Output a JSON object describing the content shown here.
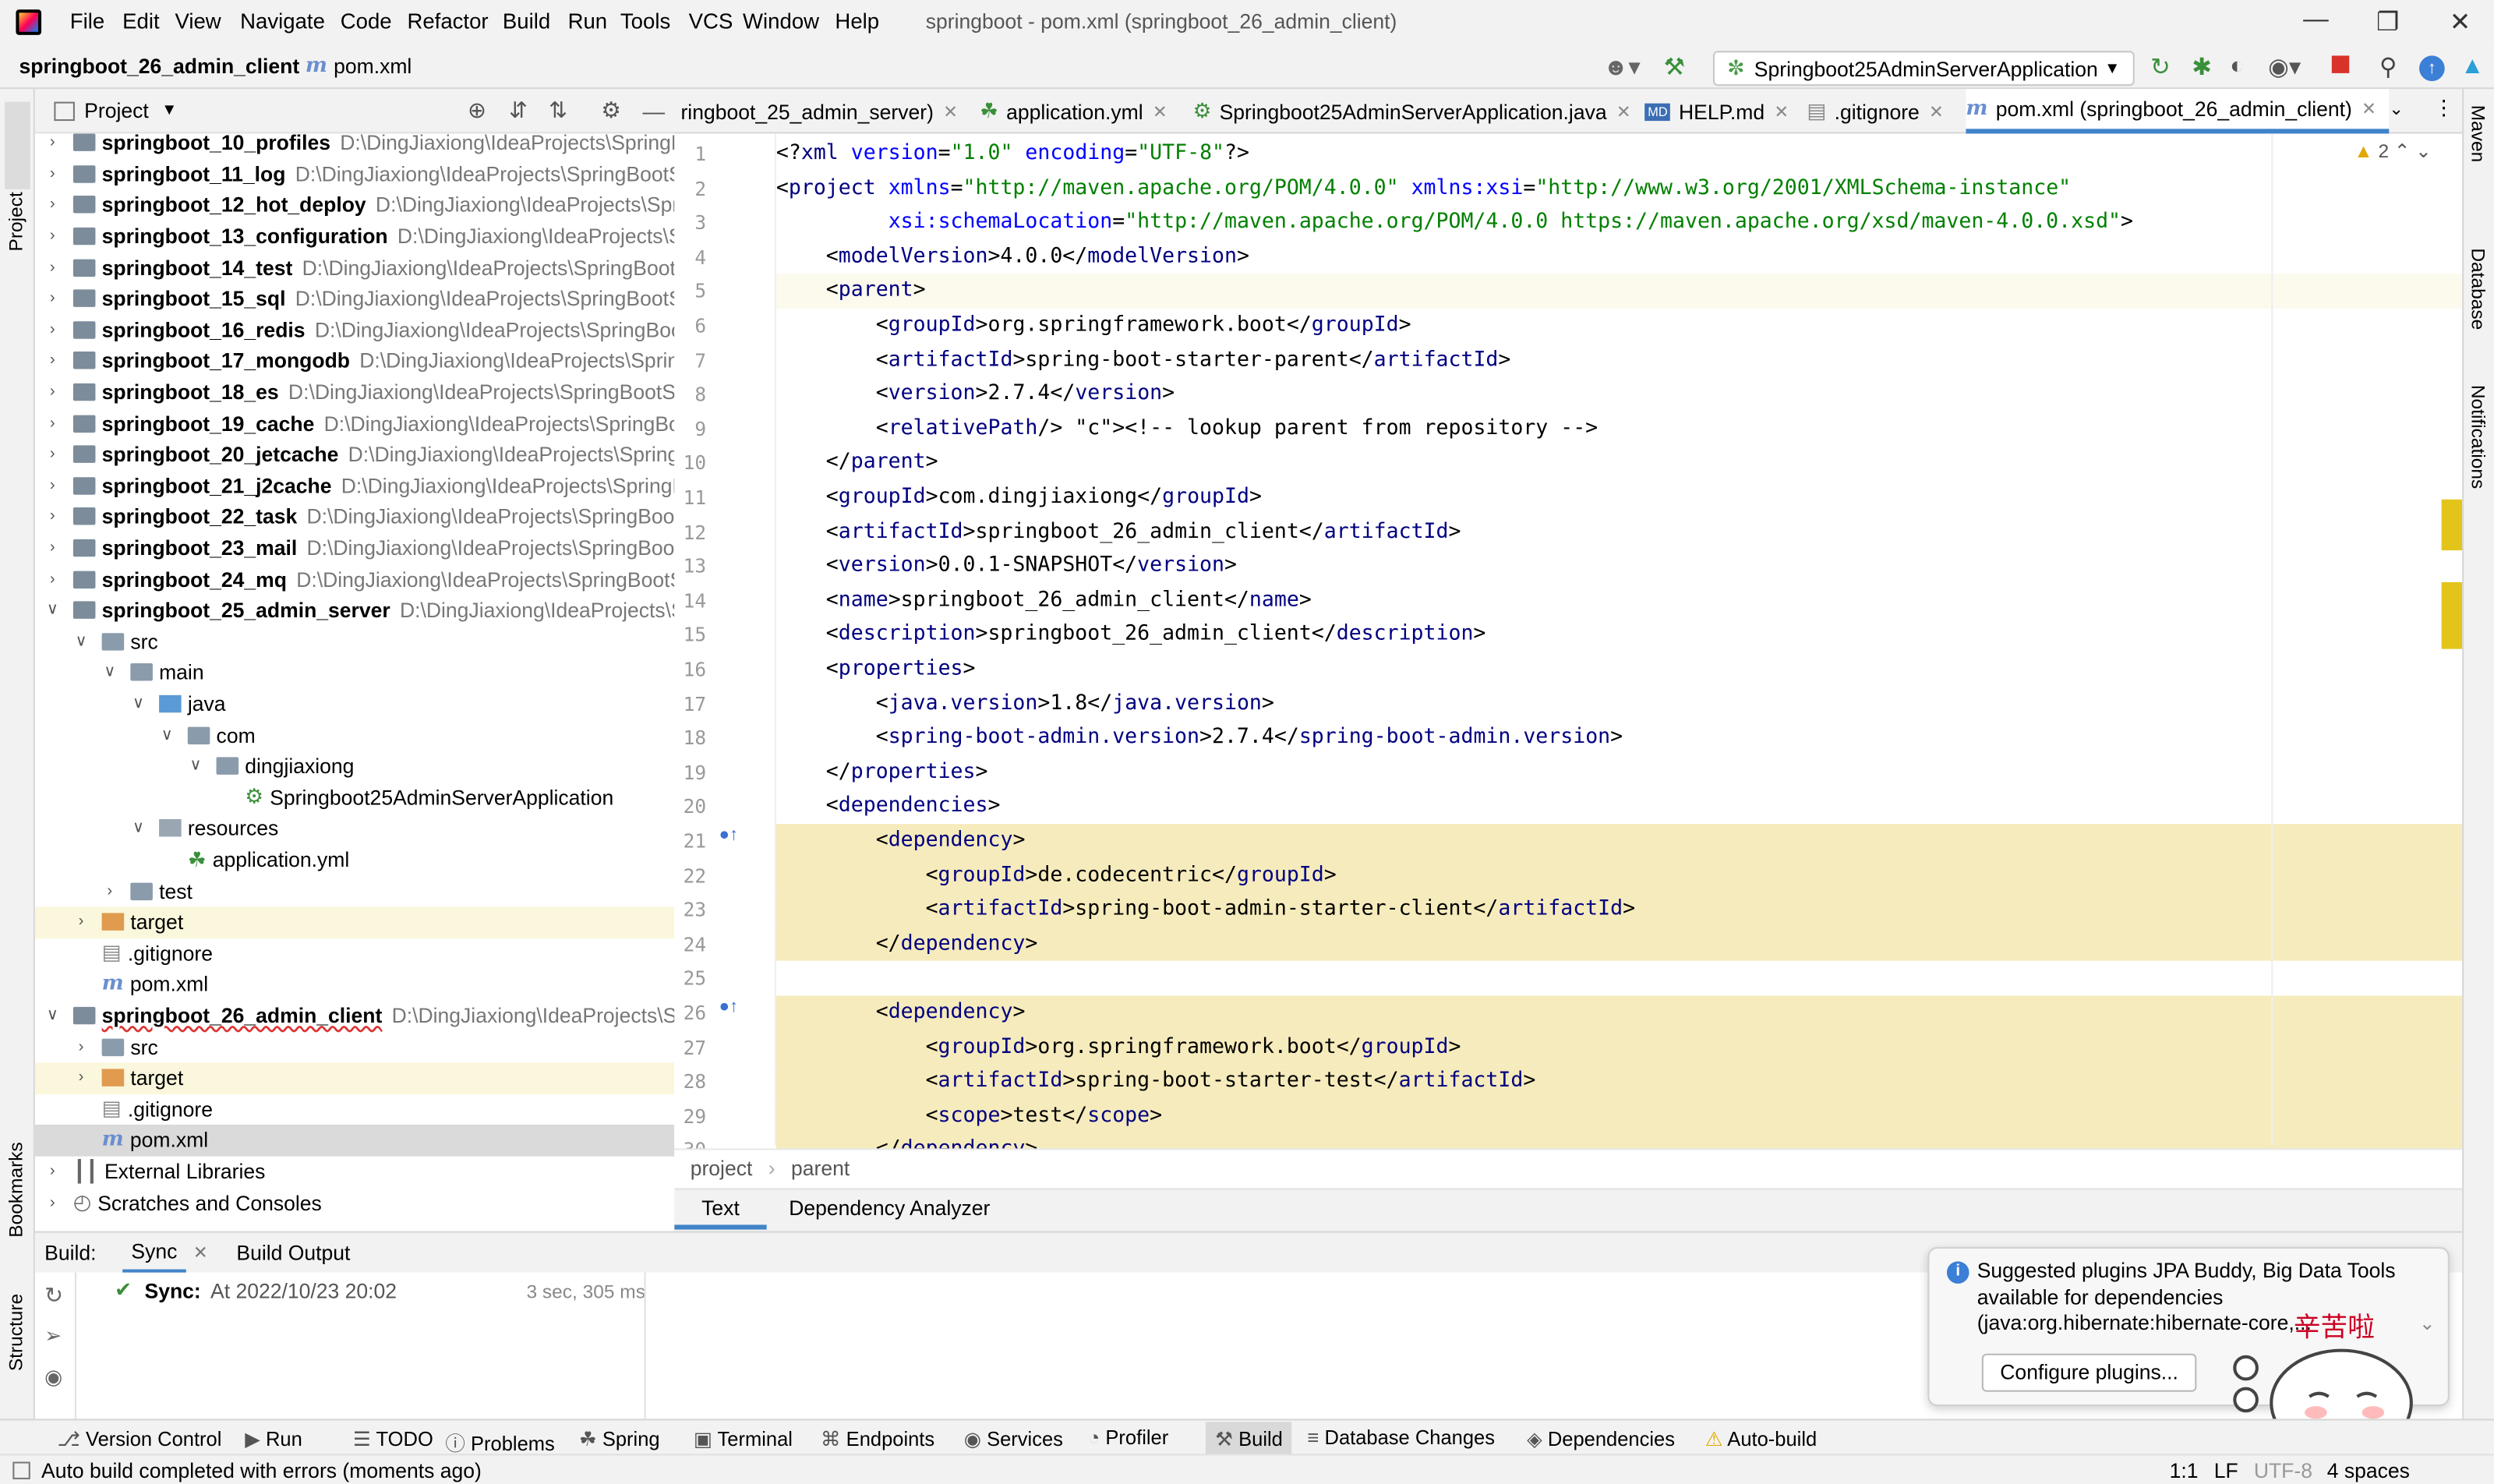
{
  "menu": [
    "File",
    "Edit",
    "View",
    "Navigate",
    "Code",
    "Refactor",
    "Build",
    "Run",
    "Tools",
    "VCS",
    "Window",
    "Help"
  ],
  "window_title": "springboot - pom.xml (springboot_26_admin_client)",
  "breadcrumb": {
    "project": "springboot_26_admin_client",
    "file": "pom.xml"
  },
  "run_config": "Springboot25AdminServerApplication",
  "project_panel": {
    "title": "Project"
  },
  "tree": [
    {
      "name": "springboot_10_profiles",
      "path": "D:\\DingJiaxiong\\IdeaProjects\\SpringBo",
      "lvl": 0,
      "arr": ">",
      "bold": true
    },
    {
      "name": "springboot_11_log",
      "path": "D:\\DingJiaxiong\\IdeaProjects\\SpringBootSt",
      "lvl": 0,
      "arr": ">",
      "bold": true
    },
    {
      "name": "springboot_12_hot_deploy",
      "path": "D:\\DingJiaxiong\\IdeaProjects\\Sprin",
      "lvl": 0,
      "arr": ">",
      "bold": true
    },
    {
      "name": "springboot_13_configuration",
      "path": "D:\\DingJiaxiong\\IdeaProjects\\Sp",
      "lvl": 0,
      "arr": ">",
      "bold": true
    },
    {
      "name": "springboot_14_test",
      "path": "D:\\DingJiaxiong\\IdeaProjects\\SpringBootSt",
      "lvl": 0,
      "arr": ">",
      "bold": true
    },
    {
      "name": "springboot_15_sql",
      "path": "D:\\DingJiaxiong\\IdeaProjects\\SpringBootStu",
      "lvl": 0,
      "arr": ">",
      "bold": true
    },
    {
      "name": "springboot_16_redis",
      "path": "D:\\DingJiaxiong\\IdeaProjects\\SpringBootS",
      "lvl": 0,
      "arr": ">",
      "bold": true
    },
    {
      "name": "springboot_17_mongodb",
      "path": "D:\\DingJiaxiong\\IdeaProjects\\Spring",
      "lvl": 0,
      "arr": ">",
      "bold": true
    },
    {
      "name": "springboot_18_es",
      "path": "D:\\DingJiaxiong\\IdeaProjects\\SpringBootStu",
      "lvl": 0,
      "arr": ">",
      "bold": true
    },
    {
      "name": "springboot_19_cache",
      "path": "D:\\DingJiaxiong\\IdeaProjects\\SpringBoot",
      "lvl": 0,
      "arr": ">",
      "bold": true
    },
    {
      "name": "springboot_20_jetcache",
      "path": "D:\\DingJiaxiong\\IdeaProjects\\SpringBo",
      "lvl": 0,
      "arr": ">",
      "bold": true
    },
    {
      "name": "springboot_21_j2cache",
      "path": "D:\\DingJiaxiong\\IdeaProjects\\SpringBo",
      "lvl": 0,
      "arr": ">",
      "bold": true
    },
    {
      "name": "springboot_22_task",
      "path": "D:\\DingJiaxiong\\IdeaProjects\\SpringBootSt",
      "lvl": 0,
      "arr": ">",
      "bold": true
    },
    {
      "name": "springboot_23_mail",
      "path": "D:\\DingJiaxiong\\IdeaProjects\\SpringBootSt",
      "lvl": 0,
      "arr": ">",
      "bold": true
    },
    {
      "name": "springboot_24_mq",
      "path": "D:\\DingJiaxiong\\IdeaProjects\\SpringBootStu",
      "lvl": 0,
      "arr": ">",
      "bold": true
    },
    {
      "name": "springboot_25_admin_server",
      "path": "D:\\DingJiaxiong\\IdeaProjects\\Spr",
      "lvl": 0,
      "arr": "v",
      "bold": true
    },
    {
      "name": "src",
      "lvl": 1,
      "arr": "v",
      "icon": "folder"
    },
    {
      "name": "main",
      "lvl": 2,
      "arr": "v",
      "icon": "folder"
    },
    {
      "name": "java",
      "lvl": 3,
      "arr": "v",
      "icon": "folder-blue"
    },
    {
      "name": "com",
      "lvl": 4,
      "arr": "v",
      "icon": "folder"
    },
    {
      "name": "dingjiaxiong",
      "lvl": 5,
      "arr": "v",
      "icon": "folder"
    },
    {
      "name": "Springboot25AdminServerApplication",
      "lvl": 6,
      "icon": "spring"
    },
    {
      "name": "resources",
      "lvl": 3,
      "arr": "v",
      "icon": "folder-res"
    },
    {
      "name": "application.yml",
      "lvl": 4,
      "icon": "yml"
    },
    {
      "name": "test",
      "lvl": 2,
      "arr": ">",
      "icon": "folder"
    },
    {
      "name": "target",
      "lvl": 1,
      "arr": ">",
      "icon": "folder-orange",
      "hl": true
    },
    {
      "name": ".gitignore",
      "lvl": 1,
      "icon": "git"
    },
    {
      "name": "pom.xml",
      "lvl": 1,
      "icon": "mvn"
    },
    {
      "name": "springboot_26_admin_client",
      "path": "D:\\DingJiaxiong\\IdeaProjects\\Spr",
      "lvl": 0,
      "arr": "v",
      "bold": true
    },
    {
      "name": "src",
      "lvl": 1,
      "arr": ">",
      "icon": "folder"
    },
    {
      "name": "target",
      "lvl": 1,
      "arr": ">",
      "icon": "folder-orange",
      "hl": true
    },
    {
      "name": ".gitignore",
      "lvl": 1,
      "icon": "git"
    },
    {
      "name": "pom.xml",
      "lvl": 1,
      "icon": "mvn",
      "sel": true
    },
    {
      "name": "External Libraries",
      "lvl": 0,
      "arr": ">",
      "icon": "lib"
    },
    {
      "name": "Scratches and Consoles",
      "lvl": 0,
      "arr": ">",
      "icon": "scratch"
    }
  ],
  "tabs": [
    {
      "label": "ringboot_25_admin_server)",
      "active": false
    },
    {
      "label": "application.yml",
      "active": false
    },
    {
      "label": "Springboot25AdminServerApplication.java",
      "active": false
    },
    {
      "label": "HELP.md",
      "active": false
    },
    {
      "label": ".gitignore",
      "active": false
    },
    {
      "label": "pom.xml (springboot_26_admin_client)",
      "active": true
    }
  ],
  "inspection_count": "2",
  "code_lines": [
    "<?xml version=\"1.0\" encoding=\"UTF-8\"?>",
    "<project xmlns=\"http://maven.apache.org/POM/4.0.0\" xmlns:xsi=\"http://www.w3.org/2001/XMLSchema-instance\"",
    "         xsi:schemaLocation=\"http://maven.apache.org/POM/4.0.0 https://maven.apache.org/xsd/maven-4.0.0.xsd\">",
    "    <modelVersion>4.0.0</modelVersion>",
    "    <parent>",
    "        <groupId>org.springframework.boot</groupId>",
    "        <artifactId>spring-boot-starter-parent</artifactId>",
    "        <version>2.7.4</version>",
    "        <relativePath/> <!-- lookup parent from repository -->",
    "    </parent>",
    "    <groupId>com.dingjiaxiong</groupId>",
    "    <artifactId>springboot_26_admin_client</artifactId>",
    "    <version>0.0.1-SNAPSHOT</version>",
    "    <name>springboot_26_admin_client</name>",
    "    <description>springboot_26_admin_client</description>",
    "    <properties>",
    "        <java.version>1.8</java.version>",
    "        <spring-boot-admin.version>2.7.4</spring-boot-admin.version>",
    "    </properties>",
    "    <dependencies>",
    "        <dependency>",
    "            <groupId>de.codecentric</groupId>",
    "            <artifactId>spring-boot-admin-starter-client</artifactId>",
    "        </dependency>",
    "",
    "        <dependency>",
    "            <groupId>org.springframework.boot</groupId>",
    "            <artifactId>spring-boot-starter-test</artifactId>",
    "            <scope>test</scope>",
    "        </dependency>"
  ],
  "editor_breadcrumb": [
    "project",
    "parent"
  ],
  "editor_bottom_tabs": [
    "Text",
    "Dependency Analyzer"
  ],
  "right_stripe": [
    "Maven",
    "Database",
    "Notifications"
  ],
  "left_stripe": [
    "Project",
    "Bookmarks",
    "Structure"
  ],
  "build": {
    "label": "Build:",
    "tabs": [
      "Sync",
      "Build Output"
    ],
    "sync_title": "Sync:",
    "sync_time": "At 2022/10/23 20:02",
    "duration": "3 sec, 305 ms"
  },
  "bottom_tabs": [
    "Version Control",
    "Run",
    "TODO",
    "Problems",
    "Spring",
    "Terminal",
    "Endpoints",
    "Services",
    "Profiler",
    "Build",
    "Database Changes",
    "Dependencies",
    "Auto-build"
  ],
  "status": {
    "message": "Auto build completed with errors (moments ago)",
    "position": "1:1",
    "line_sep": "LF",
    "encoding": "UTF-8",
    "indent": "4 spaces"
  },
  "notification": {
    "text": "Suggested plugins JPA Buddy, Big Data Tools available for dependencies (java:org.hibernate:hibernate-core,...",
    "button": "Configure plugins..."
  },
  "sticker_text": "辛苦啦"
}
